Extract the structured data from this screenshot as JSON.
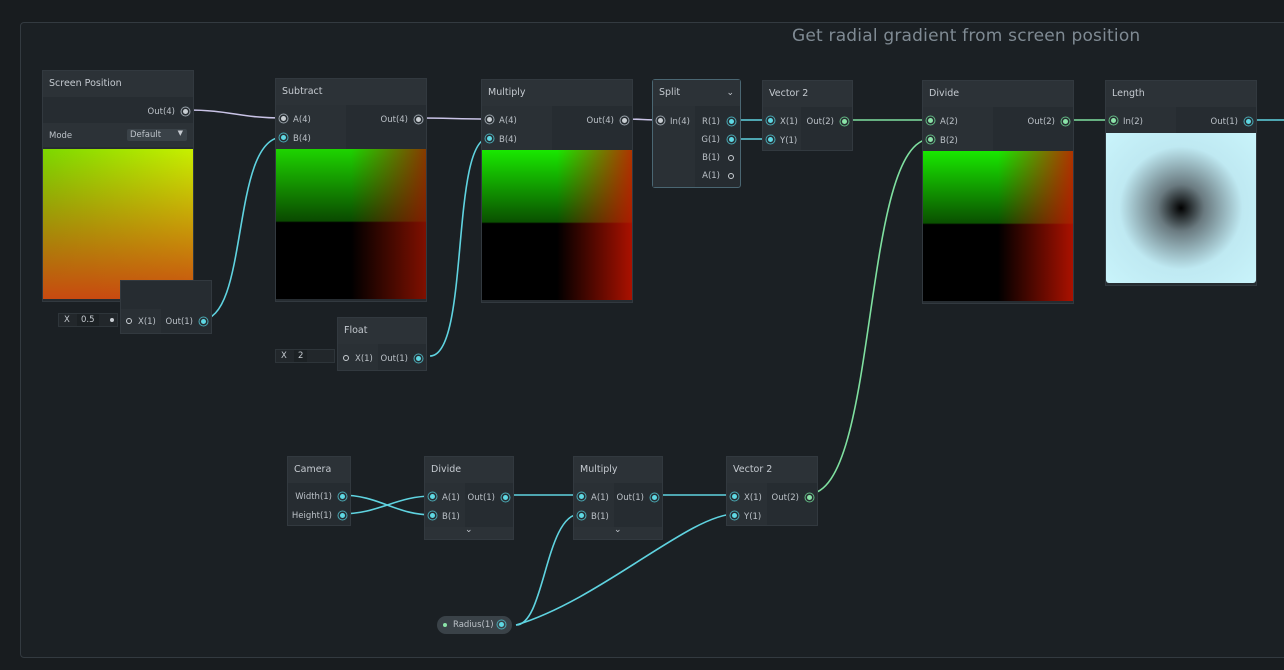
{
  "group": {
    "title": "Get radial gradient from screen position"
  },
  "nodes": {
    "screen_position": {
      "title": "Screen Position",
      "out": "Out(4)",
      "mode_label": "Mode",
      "mode_value": "Default"
    },
    "vector1_a": {
      "in_x": "X(1)",
      "out": "Out(1)",
      "field_label": "X",
      "field_value": "0.5"
    },
    "subtract": {
      "title": "Subtract",
      "in_a": "A(4)",
      "in_b": "B(4)",
      "out": "Out(4)"
    },
    "float": {
      "title": "Float",
      "in_x": "X(1)",
      "out": "Out(1)",
      "field_label": "X",
      "field_value": "2"
    },
    "multiply_top": {
      "title": "Multiply",
      "in_a": "A(4)",
      "in_b": "B(4)",
      "out": "Out(4)"
    },
    "split": {
      "title": "Split",
      "in": "In(4)",
      "out_r": "R(1)",
      "out_g": "G(1)",
      "out_b": "B(1)",
      "out_a": "A(1)"
    },
    "vector2_top": {
      "title": "Vector 2",
      "in_x": "X(1)",
      "in_y": "Y(1)",
      "out": "Out(2)"
    },
    "divide_top": {
      "title": "Divide",
      "in_a": "A(2)",
      "in_b": "B(2)",
      "out": "Out(2)"
    },
    "length": {
      "title": "Length",
      "in": "In(2)",
      "out": "Out(1)"
    },
    "camera": {
      "title": "Camera",
      "out_width": "Width(1)",
      "out_height": "Height(1)"
    },
    "divide_bottom": {
      "title": "Divide",
      "in_a": "A(1)",
      "in_b": "B(1)",
      "out": "Out(1)"
    },
    "multiply_bottom": {
      "title": "Multiply",
      "in_a": "A(1)",
      "in_b": "B(1)",
      "out": "Out(1)"
    },
    "vector2_bottom": {
      "title": "Vector 2",
      "in_x": "X(1)",
      "in_y": "Y(1)",
      "out": "Out(2)"
    },
    "radius": {
      "label": "Radius(1)"
    }
  },
  "colors": {
    "wire_vec4": "#c9c3e6",
    "wire_vec1": "#5fd3e0",
    "wire_vec2": "#7fe0a0",
    "background": "#181c1f"
  }
}
